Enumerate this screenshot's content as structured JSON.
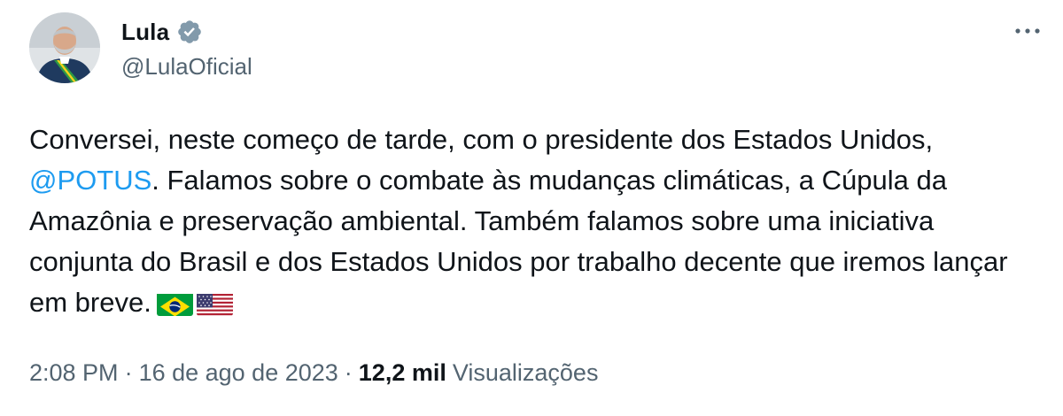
{
  "author": {
    "display_name": "Lula",
    "handle": "@LulaOficial",
    "avatar": "profile-photo",
    "verified_icon": "verified-badge-icon"
  },
  "menu_icon": "more-options-icon",
  "tweet": {
    "part1": "Conversei, neste começo de tarde, com o presidente dos Estados Unidos, ",
    "mention": "@POTUS",
    "part2": ". Falamos sobre o combate às mudanças climáticas, a Cúpula da Amazônia e preservação ambiental. Também falamos sobre uma iniciativa conjunta do Brasil e dos Estados Unidos por trabalho decente que iremos lançar em breve.",
    "emojis": [
      "brazil-flag",
      "usa-flag"
    ]
  },
  "meta": {
    "time": "2:08 PM",
    "separator": "·",
    "date": "16 de ago de 2023",
    "views_count": "12,2 mil",
    "views_label": "Visualizações"
  },
  "colors": {
    "link": "#1d9bf0",
    "secondary_text": "#536471",
    "primary_text": "#0f1419",
    "verified": "#829aab"
  }
}
